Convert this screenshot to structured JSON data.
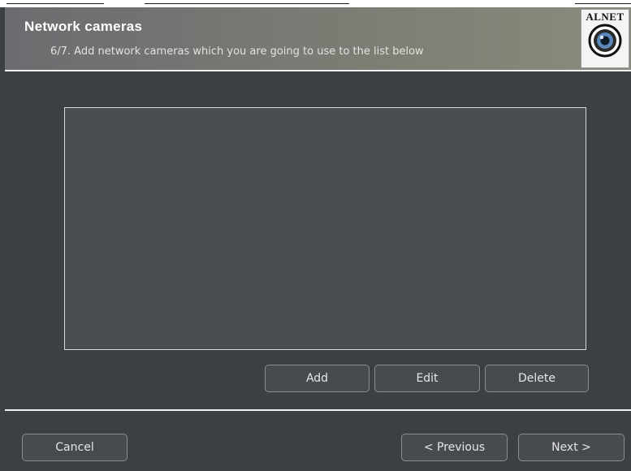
{
  "header": {
    "title": "Network cameras",
    "subtitle": "6/7. Add network cameras which you are going to use to the list below",
    "logo_text": "ALNET"
  },
  "camera_list": {
    "items": []
  },
  "list_actions": {
    "add_label": "Add",
    "edit_label": "Edit",
    "delete_label": "Delete"
  },
  "footer": {
    "cancel_label": "Cancel",
    "previous_label": "< Previous",
    "next_label": "Next >"
  },
  "colors": {
    "background": "#3c4045",
    "header": "#7b7d74",
    "list_background": "#494c50",
    "button_background": "#474b50",
    "separator": "#f0f0f0"
  },
  "icons": {
    "logo": "camera-lens-icon"
  }
}
